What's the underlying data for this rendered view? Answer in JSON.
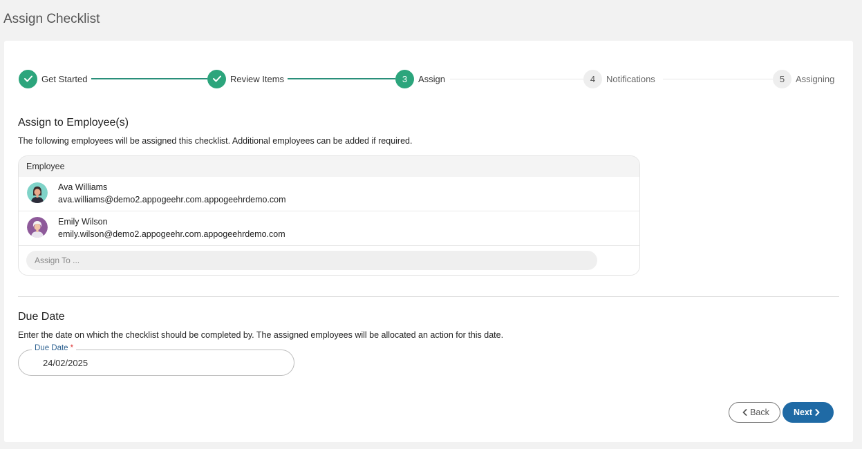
{
  "page": {
    "title": "Assign Checklist"
  },
  "stepper": {
    "steps": [
      {
        "number": "1",
        "label": "Get Started",
        "state": "done"
      },
      {
        "number": "2",
        "label": "Review Items",
        "state": "done"
      },
      {
        "number": "3",
        "label": "Assign",
        "state": "active"
      },
      {
        "number": "4",
        "label": "Notifications",
        "state": "todo"
      },
      {
        "number": "5",
        "label": "Assigning",
        "state": "todo"
      }
    ]
  },
  "assign": {
    "title": "Assign to Employee(s)",
    "description": "The following employees will be assigned this checklist. Additional employees can be added if required.",
    "column_header": "Employee",
    "employees": [
      {
        "name": "Ava Williams",
        "email": "ava.williams@demo2.appogeehr.com.appogeehrdemo.com",
        "avatar_icon": "female-avatar-icon"
      },
      {
        "name": "Emily Wilson",
        "email": "emily.wilson@demo2.appogeehr.com.appogeehrdemo.com",
        "avatar_icon": "elderly-female-avatar-icon"
      }
    ],
    "assign_placeholder": "Assign To ..."
  },
  "due_date": {
    "title": "Due Date",
    "description": "Enter the date on which the checklist should be completed by. The assigned employees will be allocated an action for this date.",
    "field_label": "Due Date",
    "required_mark": "*",
    "value": "24/02/2025"
  },
  "actions": {
    "back_label": "Back",
    "next_label": "Next"
  },
  "colors": {
    "accent_green": "#2ca57c",
    "primary_blue": "#1f6aa5"
  }
}
